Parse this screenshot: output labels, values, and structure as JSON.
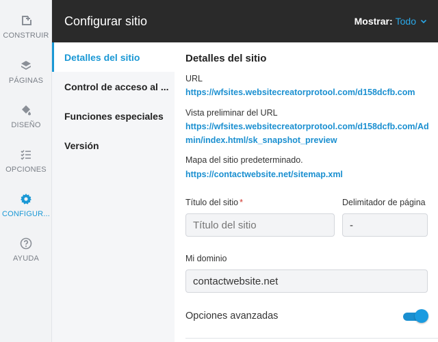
{
  "rail": {
    "items": [
      {
        "label": "CONSTRUIR",
        "icon": "add-page-icon",
        "active": false
      },
      {
        "label": "PÁGINAS",
        "icon": "layers-icon",
        "active": false
      },
      {
        "label": "DISEÑO",
        "icon": "paint-bucket-icon",
        "active": false
      },
      {
        "label": "OPCIONES",
        "icon": "checklist-icon",
        "active": false
      },
      {
        "label": "CONFIGUR...",
        "icon": "gear-icon",
        "active": true
      },
      {
        "label": "AYUDA",
        "icon": "help-icon",
        "active": false
      }
    ]
  },
  "header": {
    "title": "Configurar sitio",
    "show_label": "Mostrar:",
    "show_value": "Todo"
  },
  "subnav": {
    "items": [
      {
        "label": "Detalles del sitio",
        "active": true
      },
      {
        "label": "Control de acceso al ..."
      },
      {
        "label": "Funciones especiales"
      },
      {
        "label": "Versión"
      }
    ]
  },
  "main": {
    "section_title": "Detalles del sitio",
    "url_label": "URL",
    "url_value": "https://wfsites.websitecreatorprotool.com/d158dcfb.com",
    "preview_label": "Vista preliminar del URL",
    "preview_value": "https://wfsites.websitecreatorprotool.com/d158dcfb.com/Admin/index.html/sk_snapshot_preview",
    "sitemap_label": "Mapa del sitio predeterminado.",
    "sitemap_value": "https://contactwebsite.net/sitemap.xml",
    "title_label": "Título del sitio",
    "title_required": "*",
    "title_placeholder": "Título del sitio",
    "delimiter_label": "Delimitador de página",
    "delimiter_value": "-",
    "domain_label": "Mi dominio",
    "domain_value": "contactwebsite.net",
    "advanced_label": "Opciones avanzadas",
    "advanced_on": true
  },
  "colors": {
    "accent": "#1a98d5",
    "header_bg": "#2a2a2a",
    "link": "#1a8fd0",
    "required": "#d0342c"
  }
}
